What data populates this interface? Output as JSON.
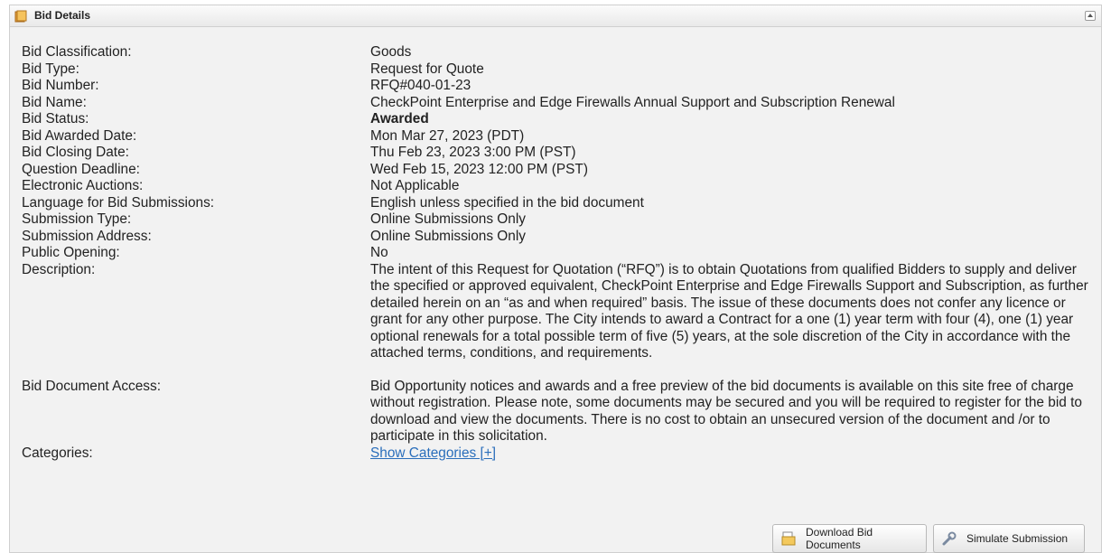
{
  "panel": {
    "title": "Bid Details",
    "icon": "folder-icon",
    "collapse_icon": "collapse-icon"
  },
  "details": {
    "classification": {
      "label": "Bid Classification:",
      "value": "Goods"
    },
    "type": {
      "label": "Bid Type:",
      "value": "Request for Quote"
    },
    "number": {
      "label": "Bid Number:",
      "value": "RFQ#040-01-23"
    },
    "name": {
      "label": "Bid Name:",
      "value": "CheckPoint Enterprise and Edge Firewalls Annual Support and Subscription Renewal"
    },
    "status": {
      "label": "Bid Status:",
      "value": "Awarded"
    },
    "awarded_date": {
      "label": "Bid Awarded Date:",
      "value": "Mon Mar 27, 2023 (PDT)"
    },
    "closing_date": {
      "label": "Bid Closing Date:",
      "value": "Thu Feb 23, 2023 3:00 PM (PST)"
    },
    "question_deadline": {
      "label": "Question Deadline:",
      "value": "Wed Feb 15, 2023 12:00 PM (PST)"
    },
    "electronic_auctions": {
      "label": "Electronic Auctions:",
      "value": "Not Applicable"
    },
    "language": {
      "label": "Language for Bid Submissions:",
      "value": "English unless specified in the bid document"
    },
    "submission_type": {
      "label": "Submission Type:",
      "value": "Online Submissions Only"
    },
    "submission_address": {
      "label": "Submission Address:",
      "value": "Online Submissions Only"
    },
    "public_opening": {
      "label": "Public Opening:",
      "value": "No"
    },
    "description": {
      "label": "Description:",
      "value": "The intent of this Request for Quotation (“RFQ”) is to obtain Quotations from qualified Bidders to supply and deliver the specified or approved equivalent, CheckPoint Enterprise and Edge Firewalls Support and Subscription, as further detailed herein on an “as and when required” basis. The issue of these documents does not confer any licence or grant for any other purpose. The City intends to award a Contract for a one (1) year term with four (4), one (1) year optional renewals for a total possible term of five (5) years, at the sole discretion of the City in accordance with the attached terms, conditions, and requirements."
    },
    "document_access": {
      "label": "Bid Document Access:",
      "value": "Bid Opportunity notices and awards and a free preview of the bid documents is available on this site free of charge without registration. Please note, some documents may be secured and you will be required to register for the bid to download and view the documents. There is no cost to obtain an unsecured version of the document and /or to participate in this solicitation."
    },
    "categories": {
      "label": "Categories:",
      "link": "Show Categories [+]"
    }
  },
  "buttons": {
    "download": {
      "label": "Download Bid Documents",
      "icon": "document-icon"
    },
    "simulate": {
      "label": "Simulate Submission",
      "icon": "wrench-icon"
    }
  }
}
